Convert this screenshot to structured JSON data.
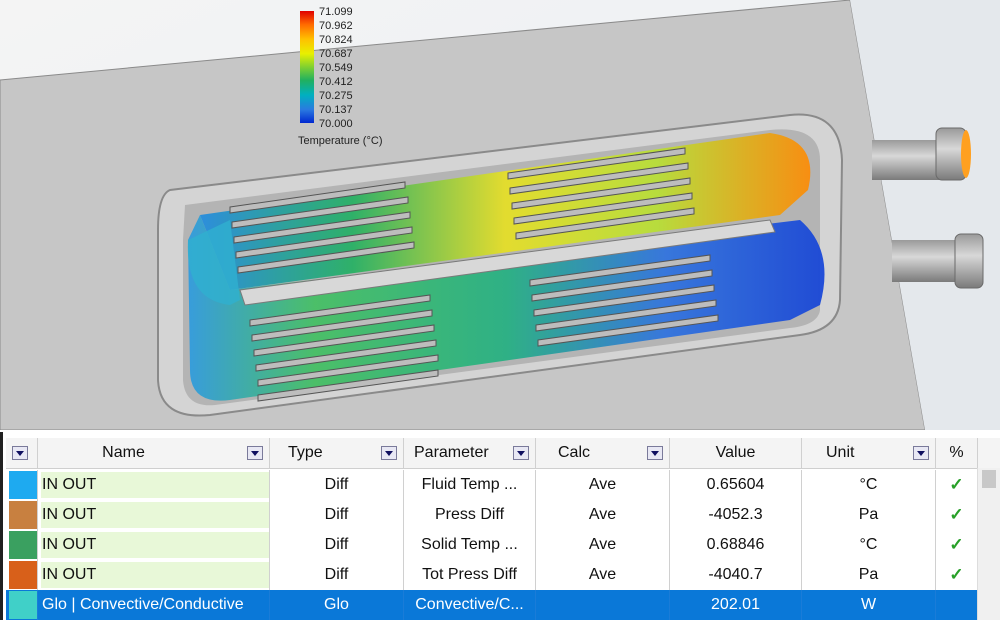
{
  "legend": {
    "ticks": [
      "71.099",
      "70.962",
      "70.824",
      "70.687",
      "70.549",
      "70.412",
      "70.275",
      "70.137",
      "70.000"
    ],
    "title": "Temperature (°C)"
  },
  "table": {
    "headers": {
      "name": "Name",
      "type": "Type",
      "parameter": "Parameter",
      "calc": "Calc",
      "value": "Value",
      "unit": "Unit",
      "percent": "%"
    },
    "rows": [
      {
        "color": "#1eaaf0",
        "name": "IN OUT",
        "type": "Diff",
        "parameter": "Fluid Temp ...",
        "calc": "Ave",
        "value": "0.65604",
        "unit": "°C",
        "check": "✓",
        "selected": false
      },
      {
        "color": "#c88040",
        "name": "IN OUT",
        "type": "Diff",
        "parameter": "Press Diff",
        "calc": "Ave",
        "value": "-4052.3",
        "unit": "Pa",
        "check": "✓",
        "selected": false
      },
      {
        "color": "#3aa060",
        "name": "IN OUT",
        "type": "Diff",
        "parameter": "Solid Temp ...",
        "calc": "Ave",
        "value": "0.68846",
        "unit": "°C",
        "check": "✓",
        "selected": false
      },
      {
        "color": "#d8601a",
        "name": "IN OUT",
        "type": "Diff",
        "parameter": "Tot Press Diff",
        "calc": "Ave",
        "value": "-4040.7",
        "unit": "Pa",
        "check": "✓",
        "selected": false
      },
      {
        "color": "#40d0c8",
        "name": "Glo | Convective/Conductive",
        "type": "Glo",
        "parameter": "Convective/C...",
        "calc": "",
        "value": "202.01",
        "unit": "W",
        "check": "",
        "selected": true
      }
    ]
  }
}
